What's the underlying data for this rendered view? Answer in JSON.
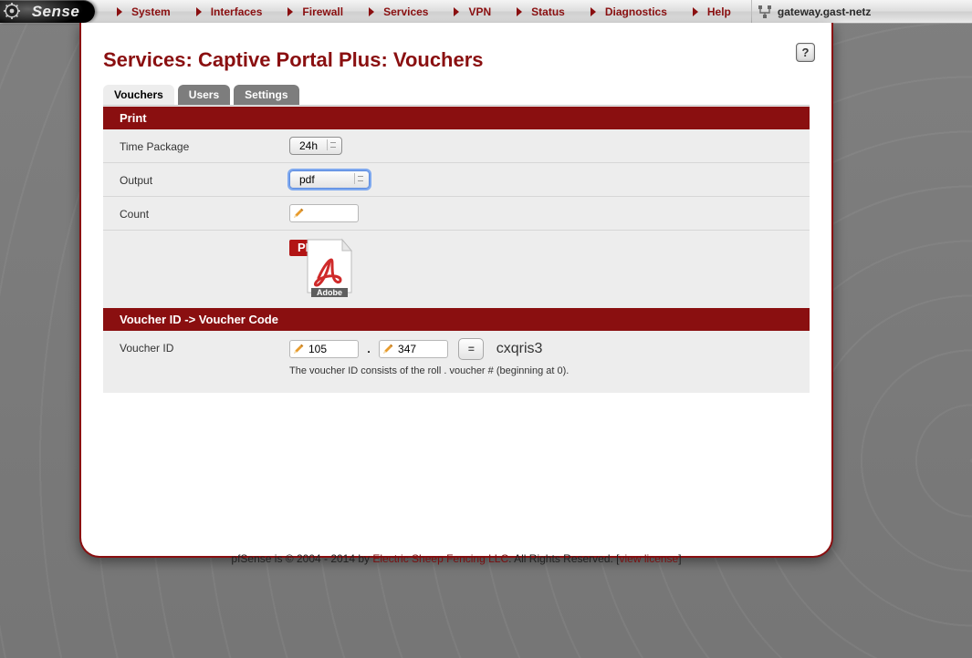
{
  "brand": "Sense",
  "hostname": "gateway.gast-netz",
  "menu": [
    "System",
    "Interfaces",
    "Firewall",
    "Services",
    "VPN",
    "Status",
    "Diagnostics",
    "Help"
  ],
  "page_title": "Services: Captive Portal Plus: Vouchers",
  "help_glyph": "?",
  "tabs": [
    {
      "label": "Vouchers",
      "active": true
    },
    {
      "label": "Users",
      "active": false
    },
    {
      "label": "Settings",
      "active": false
    }
  ],
  "section_print": {
    "header": "Print",
    "rows": {
      "time_package": {
        "label": "Time Package",
        "value": "24h"
      },
      "output": {
        "label": "Output",
        "value": "pdf"
      },
      "count": {
        "label": "Count",
        "value": ""
      }
    },
    "pdf_badge": "PDF",
    "pdf_adobe": "Adobe"
  },
  "section_lookup": {
    "header": "Voucher ID -> Voucher Code",
    "label": "Voucher ID",
    "roll": "105",
    "num": "347",
    "sep": ".",
    "eq": "=",
    "code": "cxqris3",
    "hint": "The voucher ID consists of the roll . voucher # (beginning at 0)."
  },
  "footer": {
    "pre": "pfSense is © 2004 - 2014 by ",
    "link1": "Electric Sheep Fencing LLC",
    "mid": ". All Rights Reserved. [",
    "link2": "view license",
    "post": "]"
  }
}
